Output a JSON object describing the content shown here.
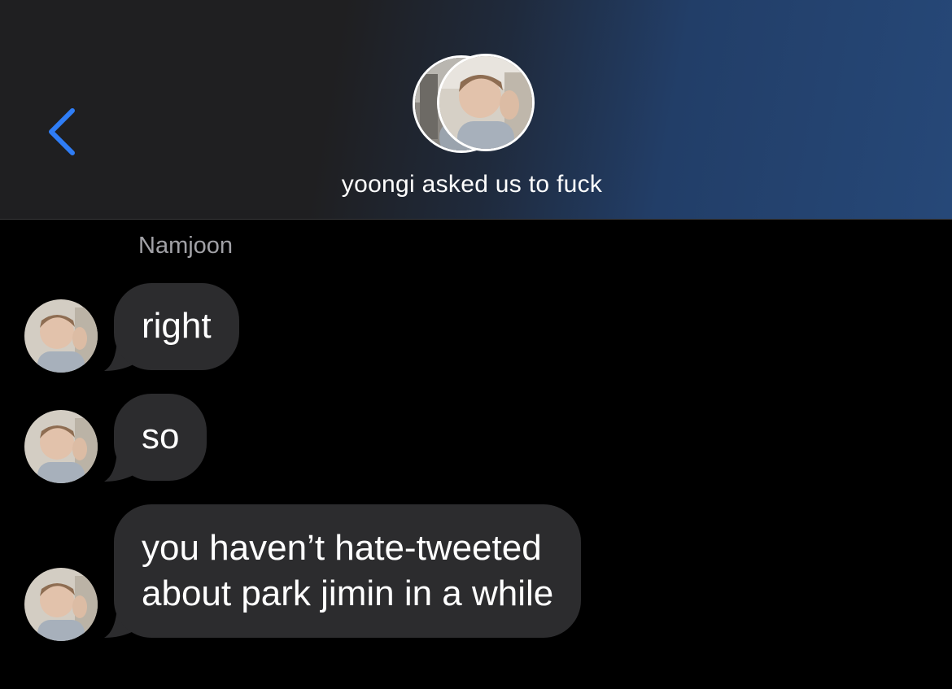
{
  "header": {
    "back_icon": "chevron-left-icon",
    "group_title": "yoongi asked us to fuck",
    "accent_color": "#2f7df6"
  },
  "conversation": {
    "sender": "Namjoon",
    "bubble_color": "#2c2c2e",
    "messages": [
      {
        "lines": [
          "right"
        ]
      },
      {
        "lines": [
          "so"
        ]
      },
      {
        "lines": [
          "you haven’t hate-tweeted",
          "about park jimin in a while"
        ]
      }
    ]
  }
}
